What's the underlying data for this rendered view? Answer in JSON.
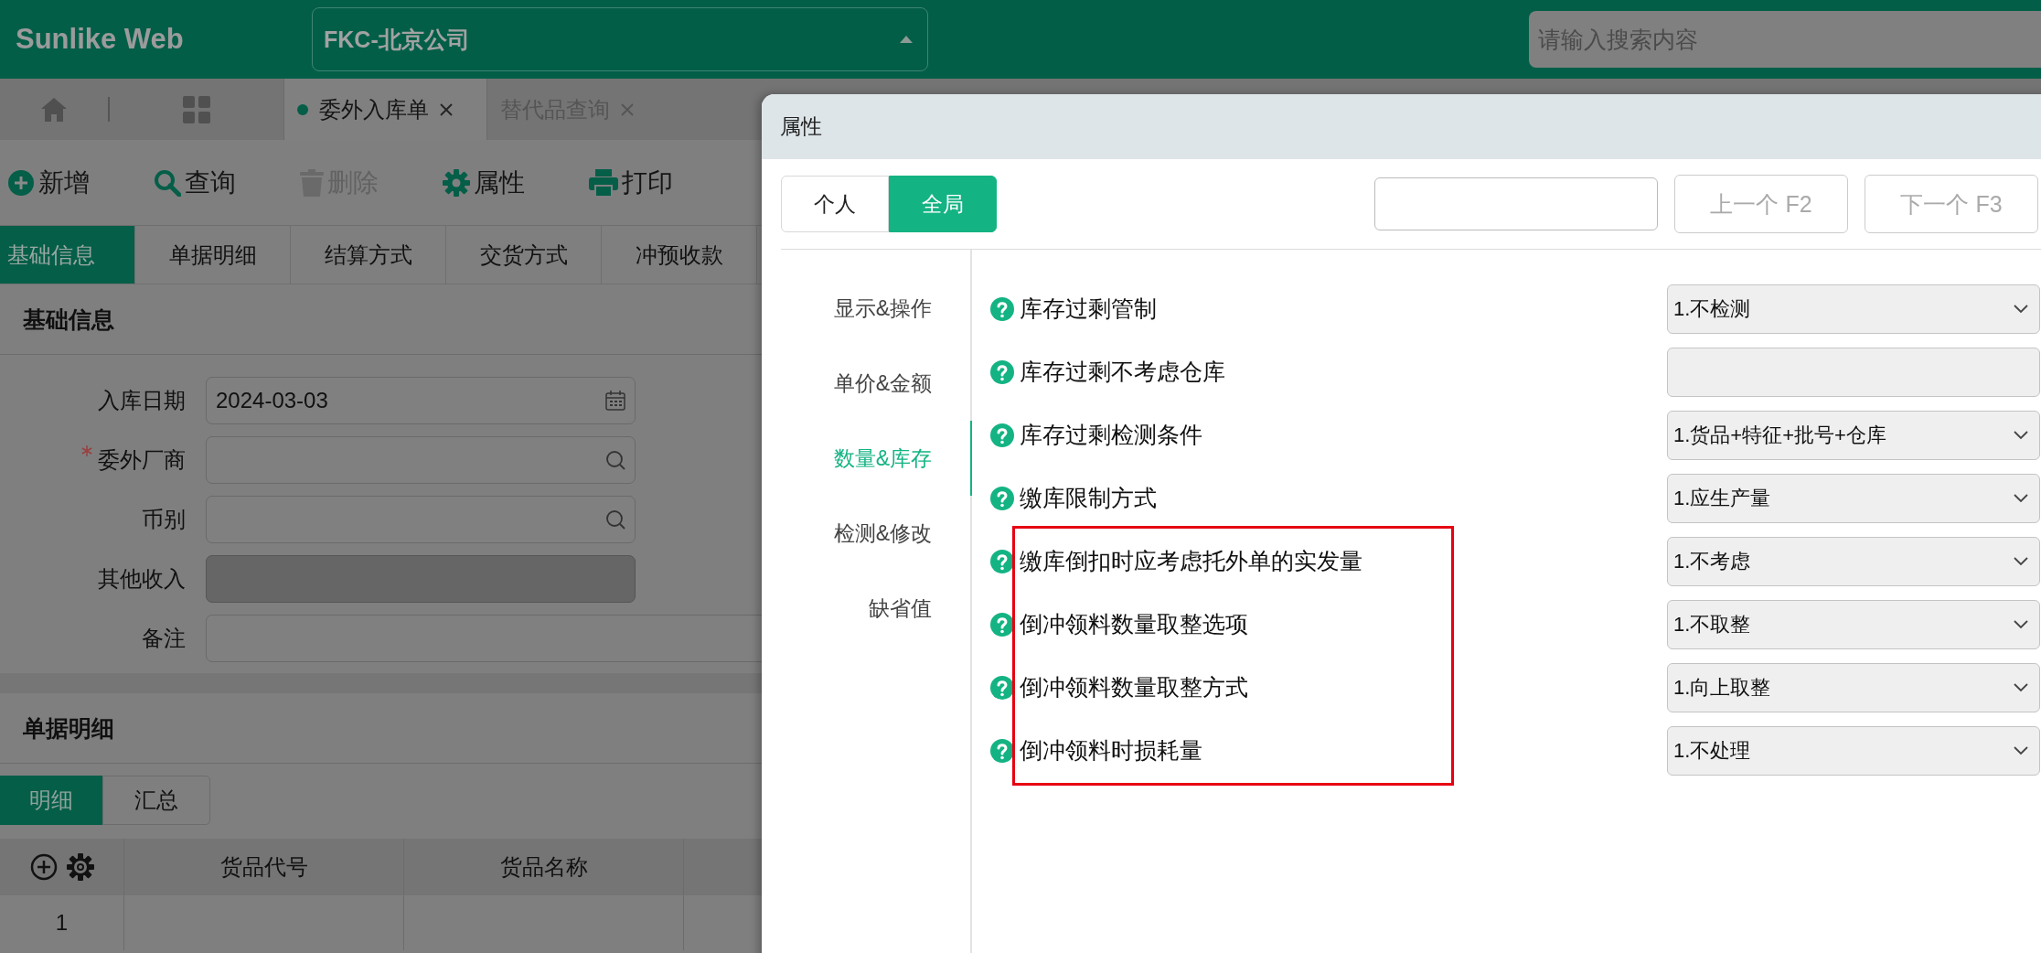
{
  "header": {
    "logo": "Sunlike Web",
    "company": "FKC-北京公司",
    "search": {
      "placeholder": "请输入搜索内容"
    }
  },
  "tabs": [
    {
      "label": "委外入库单",
      "selected": true
    },
    {
      "label": "替代品查询",
      "selected": false
    }
  ],
  "toolbar": [
    {
      "label": "新增",
      "kind": "add",
      "disabled": false
    },
    {
      "label": "查询",
      "kind": "search",
      "disabled": false
    },
    {
      "label": "删除",
      "kind": "delete",
      "disabled": true
    },
    {
      "label": "属性",
      "kind": "settings",
      "disabled": false
    },
    {
      "label": "打印",
      "kind": "print",
      "disabled": false
    }
  ],
  "section_tabs": [
    {
      "label": "基础信息",
      "selected": true
    },
    {
      "label": "单据明细",
      "selected": false
    },
    {
      "label": "结算方式",
      "selected": false
    },
    {
      "label": "交货方式",
      "selected": false
    },
    {
      "label": "冲预收款",
      "selected": false
    }
  ],
  "basic_info": {
    "title": "基础信息",
    "fields": [
      {
        "label": "入库日期",
        "value": "2024-03-03",
        "kind": "date",
        "required": false,
        "disabled": false
      },
      {
        "label": "委外厂商",
        "kind": "lookup",
        "required": true,
        "disabled": false
      },
      {
        "label": "币别",
        "kind": "lookup",
        "required": false,
        "disabled": false
      },
      {
        "label": "其他收入",
        "kind": "text",
        "required": false,
        "disabled": true
      },
      {
        "label": "备注",
        "kind": "wide",
        "required": false,
        "disabled": false
      }
    ]
  },
  "detail": {
    "title": "单据明细",
    "tabs": [
      {
        "label": "明细",
        "selected": true
      },
      {
        "label": "汇总",
        "selected": false
      }
    ],
    "table": {
      "columns": [
        "货品代号",
        "货品名称"
      ],
      "rows": [
        {
          "number": "1"
        }
      ]
    }
  },
  "dialog": {
    "title": "属性",
    "scope_tabs": [
      {
        "label": "个人",
        "selected": false
      },
      {
        "label": "全局",
        "selected": true
      }
    ],
    "buttons": [
      {
        "label": "上一个 F2",
        "disabled": true
      },
      {
        "label": "下一个 F3",
        "disabled": true
      }
    ],
    "nav": [
      {
        "label": "显示&操作",
        "selected": false
      },
      {
        "label": "单价&金额",
        "selected": false
      },
      {
        "label": "数量&库存",
        "selected": true
      },
      {
        "label": "检测&修改",
        "selected": false
      },
      {
        "label": "缺省值",
        "selected": false
      }
    ],
    "settings": [
      {
        "label": "库存过剩管制",
        "kind": "select",
        "value": "1.不检测",
        "highlighted": false
      },
      {
        "label": "库存过剩不考虑仓库",
        "kind": "field",
        "highlighted": false
      },
      {
        "label": "库存过剩检测条件",
        "kind": "select",
        "value": "1.货品+特征+批号+仓库",
        "highlighted": false
      },
      {
        "label": "缴库限制方式",
        "kind": "select",
        "value": "1.应生产量",
        "highlighted": false
      },
      {
        "label": "缴库倒扣时应考虑托外单的实发量",
        "kind": "select",
        "value": "1.不考虑",
        "highlighted": true
      },
      {
        "label": "倒冲领料数量取整选项",
        "kind": "select",
        "value": "1.不取整",
        "highlighted": true
      },
      {
        "label": "倒冲领料数量取整方式",
        "kind": "select",
        "value": "1.向上取整",
        "highlighted": true
      },
      {
        "label": "倒冲领料时损耗量",
        "kind": "select",
        "value": "1.不处理",
        "highlighted": true
      }
    ]
  }
}
